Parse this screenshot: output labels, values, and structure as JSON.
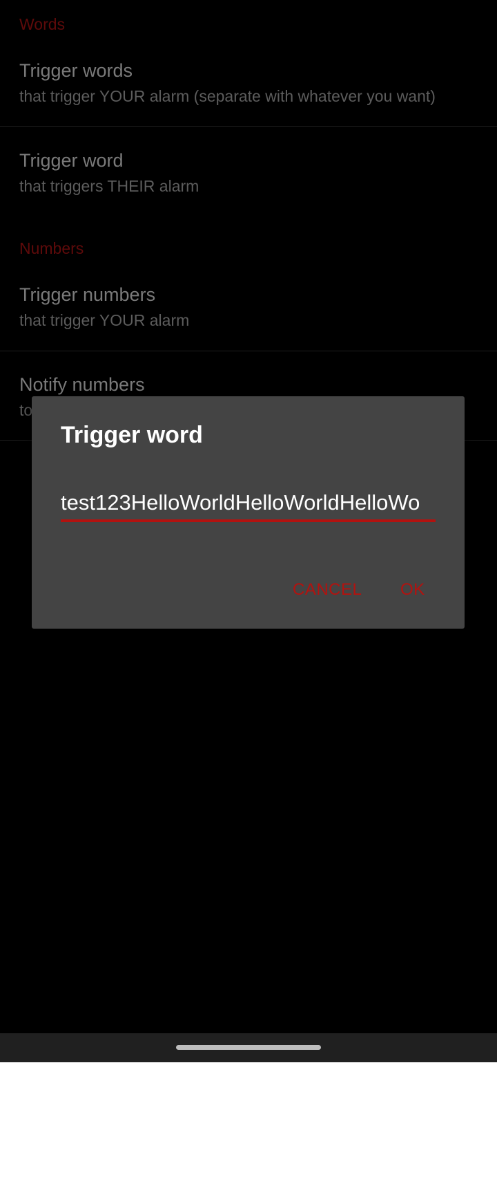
{
  "settings": {
    "categories": {
      "words": "Words",
      "numbers": "Numbers"
    },
    "items": [
      {
        "title": "Trigger words",
        "summary": "that trigger YOUR alarm (separate with whatever you want)"
      },
      {
        "title": "Trigger word",
        "summary": "that triggers THEIR alarm"
      },
      {
        "title": "Trigger numbers",
        "summary": "that trigger YOUR alarm"
      },
      {
        "title": "Notify numbers",
        "summary": "to"
      }
    ]
  },
  "dialog": {
    "title": "Trigger word",
    "input_value": "test123HelloWorldHelloWorldHelloWo",
    "cancel_label": "CANCEL",
    "ok_label": "OK"
  },
  "colors": {
    "accent": "#b3120f",
    "background": "#000000",
    "dialog_background": "#444444"
  }
}
